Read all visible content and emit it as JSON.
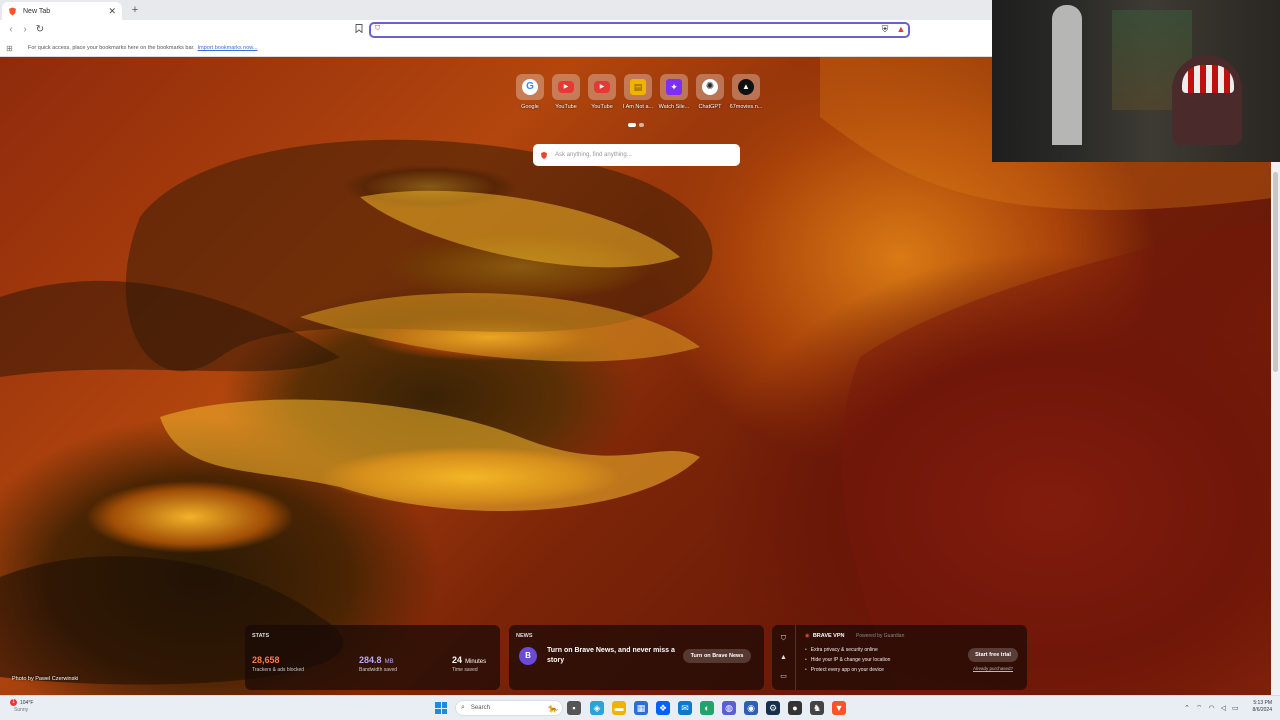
{
  "browser": {
    "tab_title": "New Tab",
    "tab_close": "✕",
    "new_tab": "+",
    "address_placeholder": "",
    "bookmarks_hint": "For quick access, place your bookmarks here on the bookmarks bar.",
    "bookmarks_link": "Import bookmarks now..."
  },
  "top_sites": [
    {
      "label": "Google",
      "glyph": "G",
      "color": "#4285f4"
    },
    {
      "label": "YouTube",
      "glyph": "▶",
      "color": "#e53935"
    },
    {
      "label": "YouTube",
      "glyph": "▶",
      "color": "#e53935"
    },
    {
      "label": "I Am Not a...",
      "glyph": "▤",
      "color": "#f0b400"
    },
    {
      "label": "Watch Sile...",
      "glyph": "✦",
      "color": "#7b2ff7"
    },
    {
      "label": "ChatGPT",
      "glyph": "✺",
      "color": "#222222"
    },
    {
      "label": "67movies.n...",
      "glyph": "▲",
      "color": "#111111"
    }
  ],
  "newtab_search": {
    "placeholder": "Ask anything, find anything..."
  },
  "photo_credit": "Photo by Pawel Czerwinski",
  "stats": {
    "heading": "STATS",
    "items": [
      {
        "value": "28,658",
        "unit": "",
        "label": "Trackers & ads blocked",
        "color": "#ff7b4a"
      },
      {
        "value": "284.8",
        "unit": "MB",
        "label": "Bandwidth saved",
        "color": "#b9a8ff"
      },
      {
        "value": "24",
        "unit": "Minutes",
        "label": "Time saved",
        "color": "#ffffff"
      }
    ]
  },
  "news": {
    "heading": "NEWS",
    "text": "Turn on Brave News, and never miss a story",
    "button": "Turn on Brave News"
  },
  "vpn": {
    "title": "BRAVE VPN",
    "powered": "Powered by Guardian",
    "features": [
      "Extra privacy & security online",
      "Hide your IP & change your location",
      "Protect every app on your device"
    ],
    "trial_button": "Start free trial",
    "already": "Already purchased?"
  },
  "taskbar": {
    "weather_temp": "104°F",
    "weather_desc": "Sunny",
    "weather_badge": "1",
    "search": "Search",
    "time": "5:13 PM",
    "date": "8/6/2024"
  }
}
